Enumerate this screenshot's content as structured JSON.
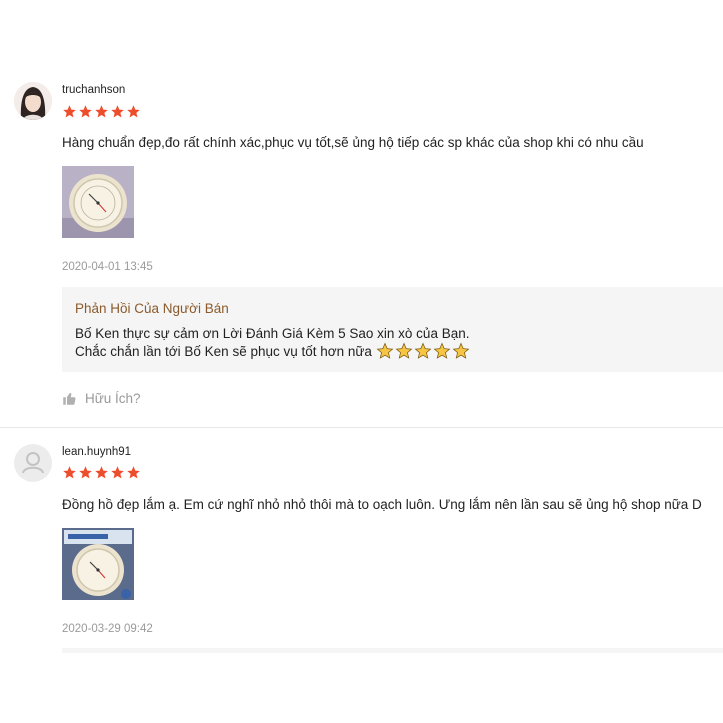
{
  "colors": {
    "star": "#ee4d2d",
    "reply_title": "#8a5a2b",
    "timestamp": "#9a9a9a",
    "reply_bg": "#f5f5f5"
  },
  "reviews": [
    {
      "username": "truchanhson",
      "rating": 5,
      "comment": "Hàng chuẩn đẹp,đo rất chính xác,phục vụ tốt,sẽ ủng hộ tiếp các sp khác của shop khi có nhu cầu",
      "timestamp": "2020-04-01 13:45",
      "seller_reply": {
        "title": "Phản Hồi Của Người Bán",
        "line1": "Bố Ken thực sự cảm ơn Lời Đánh Giá Kèm 5 Sao xin xò của Bạn.",
        "line2": "Chắc chắn lần tới Bố Ken sẽ phục vụ tốt hơn nữa"
      },
      "helpful_label": "Hữu Ích?"
    },
    {
      "username": "lean.huynh91",
      "rating": 5,
      "comment": "Đồng hồ đẹp lắm ạ. Em cứ nghĩ nhỏ nhỏ thôi mà to oạch luôn. Ưng lắm nên lần sau sẽ ủng hộ shop nữa D",
      "timestamp": "2020-03-29 09:42"
    }
  ]
}
